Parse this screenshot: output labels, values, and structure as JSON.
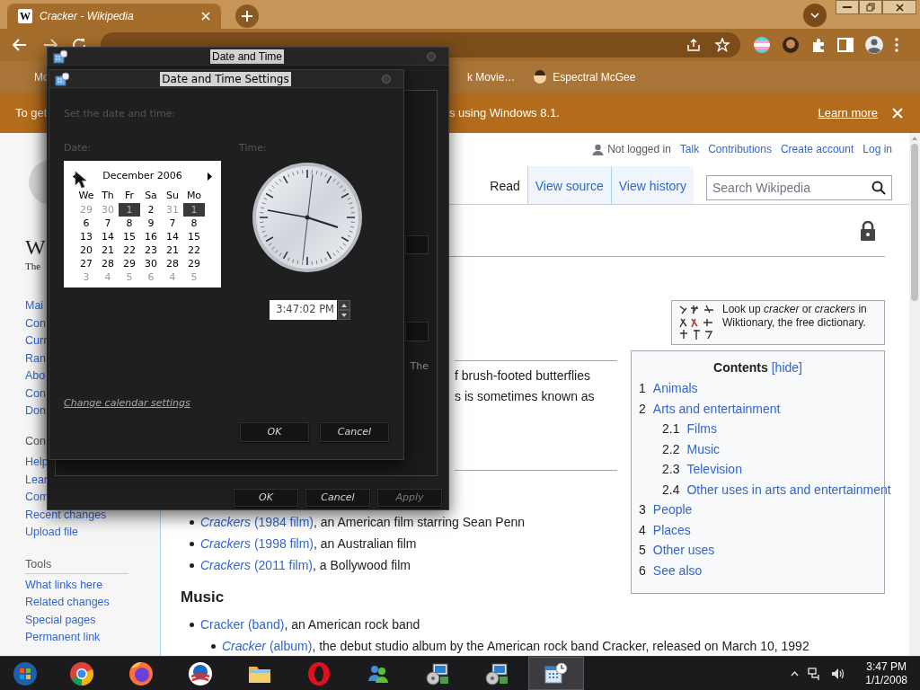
{
  "browser": {
    "tab": {
      "favicon": "W",
      "title": "Cracker - Wikipedia",
      "selected": true
    },
    "bookmarks": [
      {
        "label": "Mo",
        "icon": false
      },
      {
        "label": "k Movie…",
        "icon": false
      },
      {
        "label": "Espectral McGee",
        "icon": true
      }
    ],
    "infobar": {
      "lead": "To get",
      "tail": "s using Windows 8.1.",
      "link": "Learn more"
    }
  },
  "wiki": {
    "logo": {
      "mark": "W",
      "tagline": "The"
    },
    "sidebar": {
      "navigation": [
        "Mai",
        "Con",
        "Curr",
        "Ran",
        "Abo",
        "Con",
        "Don"
      ],
      "contribute_heading": "Con",
      "contribute": [
        "Help",
        "Lear",
        "Com",
        "Recent changes",
        "Upload file"
      ],
      "tools_heading": "Tools",
      "tools": [
        "What links here",
        "Related changes",
        "Special pages",
        "Permanent link"
      ]
    },
    "personal": [
      {
        "label": "Not logged in",
        "kind": "status"
      },
      {
        "label": "Talk",
        "kind": "link"
      },
      {
        "label": "Contributions",
        "kind": "link"
      },
      {
        "label": "Create account",
        "kind": "link"
      },
      {
        "label": "Log in",
        "kind": "link"
      }
    ],
    "tabs": [
      {
        "label": "Read",
        "selected": true
      },
      {
        "label": "View source",
        "selected": false
      },
      {
        "label": "View history",
        "selected": false
      }
    ],
    "search": {
      "placeholder": "Search Wikipedia"
    },
    "paragraph_lines": [
      "f brush-footed butterflies",
      "s is sometimes known as"
    ],
    "films": [
      {
        "title": "Crackers",
        "paren": "(1984 film)",
        "rest": ", an American film starring Sean Penn",
        "italic": true
      },
      {
        "title": "Crackers",
        "paren": "(1998 film)",
        "rest": ", an Australian film",
        "italic": true
      },
      {
        "title": "Crackers",
        "paren": "(2011 film)",
        "rest": ", a Bollywood film",
        "italic": true
      }
    ],
    "music_heading": "Music",
    "music": [
      {
        "title": "Cracker",
        "paren": "(band)",
        "rest": ", an American rock band",
        "italic": false,
        "children": [
          {
            "title": "Cracker",
            "paren": "(album)",
            "rest": ", the debut studio album by the American rock band Cracker, released on March 10, 1992",
            "italic": true
          }
        ]
      }
    ],
    "wiktionary": "Look up *cracker* or *crackers* in Wiktionary, the free dictionary.",
    "toc": {
      "title": "Contents",
      "toggle": "[hide]",
      "items": [
        {
          "number": "1",
          "label": "Animals"
        },
        {
          "number": "2",
          "label": "Arts and entertainment",
          "children": [
            {
              "number": "2.1",
              "label": "Films"
            },
            {
              "number": "2.2",
              "label": "Music"
            },
            {
              "number": "2.3",
              "label": "Television"
            },
            {
              "number": "2.4",
              "label": "Other uses in arts and entertainment"
            }
          ]
        },
        {
          "number": "3",
          "label": "People"
        },
        {
          "number": "4",
          "label": "Places"
        },
        {
          "number": "5",
          "label": "Other uses"
        },
        {
          "number": "6",
          "label": "See also"
        }
      ]
    }
  },
  "date_time_window": {
    "title": "Date and Time",
    "fragment": "The",
    "buttons": [
      {
        "label": "OK",
        "disabled": false
      },
      {
        "label": "Cancel",
        "disabled": false
      },
      {
        "label": "Apply",
        "disabled": true
      }
    ]
  },
  "settings_dialog": {
    "title": "Date and Time Settings",
    "prompt": "Set the date and time:",
    "date_label": "Date:",
    "time_label": "Time:",
    "calendar": {
      "month": "December 2006",
      "weekdays": [
        "We",
        "Th",
        "Fr",
        "Sa",
        "Su",
        "Mo"
      ],
      "weeks": [
        [
          {
            "day": "29",
            "muted": true,
            "selected": false
          },
          {
            "day": "30",
            "muted": true,
            "selected": false
          },
          {
            "day": "1",
            "muted": false,
            "selected": true
          },
          {
            "day": "2",
            "muted": false,
            "selected": false
          },
          {
            "day": "31",
            "muted": true,
            "selected": false
          },
          {
            "day": "1",
            "muted": false,
            "selected": true
          }
        ],
        [
          {
            "day": "6",
            "muted": false,
            "selected": false
          },
          {
            "day": "7",
            "muted": false,
            "selected": false
          },
          {
            "day": "8",
            "muted": false,
            "selected": false
          },
          {
            "day": "9",
            "muted": false,
            "selected": false
          },
          {
            "day": "7",
            "muted": false,
            "selected": false
          },
          {
            "day": "8",
            "muted": false,
            "selected": false
          }
        ],
        [
          {
            "day": "13",
            "muted": false,
            "selected": false
          },
          {
            "day": "14",
            "muted": false,
            "selected": false
          },
          {
            "day": "15",
            "muted": false,
            "selected": false
          },
          {
            "day": "16",
            "muted": false,
            "selected": false
          },
          {
            "day": "14",
            "muted": false,
            "selected": false
          },
          {
            "day": "15",
            "muted": false,
            "selected": false
          }
        ],
        [
          {
            "day": "20",
            "muted": false,
            "selected": false
          },
          {
            "day": "21",
            "muted": false,
            "selected": false
          },
          {
            "day": "22",
            "muted": false,
            "selected": false
          },
          {
            "day": "23",
            "muted": false,
            "selected": false
          },
          {
            "day": "21",
            "muted": false,
            "selected": false
          },
          {
            "day": "22",
            "muted": false,
            "selected": false
          }
        ],
        [
          {
            "day": "27",
            "muted": false,
            "selected": false
          },
          {
            "day": "28",
            "muted": false,
            "selected": false
          },
          {
            "day": "29",
            "muted": false,
            "selected": false
          },
          {
            "day": "30",
            "muted": false,
            "selected": false
          },
          {
            "day": "28",
            "muted": false,
            "selected": false
          },
          {
            "day": "29",
            "muted": false,
            "selected": false
          }
        ],
        [
          {
            "day": "3",
            "muted": true,
            "selected": false
          },
          {
            "day": "4",
            "muted": true,
            "selected": false
          },
          {
            "day": "5",
            "muted": true,
            "selected": false
          },
          {
            "day": "6",
            "muted": true,
            "selected": false
          },
          {
            "day": "4",
            "muted": true,
            "selected": false
          },
          {
            "day": "5",
            "muted": true,
            "selected": false
          }
        ]
      ]
    },
    "time": "3:47:02 PM",
    "link": "Change calendar settings",
    "buttons": [
      "OK",
      "Cancel"
    ]
  },
  "taskbar": {
    "apps": [
      {
        "kind": "start",
        "active": false
      },
      {
        "kind": "chrome",
        "active": false
      },
      {
        "kind": "firefox",
        "active": false
      },
      {
        "kind": "circle-logo",
        "active": false
      },
      {
        "kind": "folder",
        "active": false
      },
      {
        "kind": "opera",
        "active": false
      },
      {
        "kind": "people",
        "active": false
      },
      {
        "kind": "installer",
        "active": false
      },
      {
        "kind": "installer",
        "active": false
      },
      {
        "kind": "datetime",
        "active": true
      }
    ],
    "clock": {
      "time": "3:47 PM",
      "date": "1/1/2008"
    }
  }
}
